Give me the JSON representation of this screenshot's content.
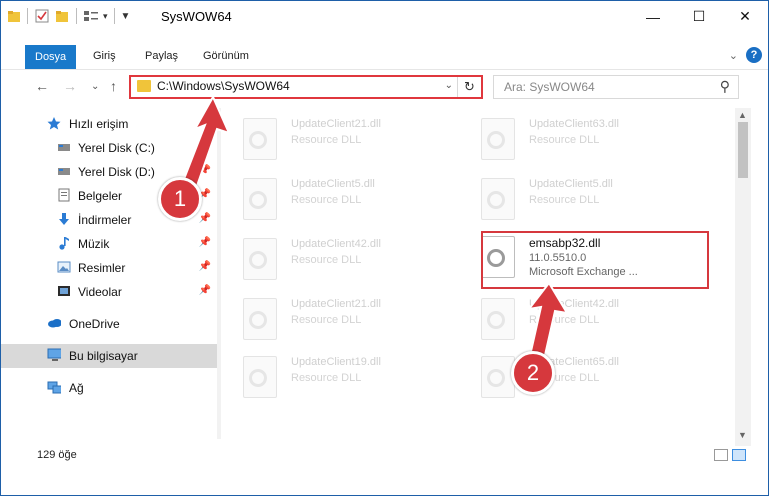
{
  "window": {
    "title": "SysWOW64"
  },
  "ribbon": {
    "tabs": [
      {
        "label": "Dosya",
        "active": true
      },
      {
        "label": "Giriş"
      },
      {
        "label": "Paylaş"
      },
      {
        "label": "Görünüm"
      }
    ]
  },
  "address": {
    "path": "C:\\Windows\\SysWOW64"
  },
  "search": {
    "placeholder": "Ara: SysWOW64"
  },
  "sidebar": {
    "items": [
      {
        "label": "Hızlı erişim",
        "icon": "star-icon"
      },
      {
        "label": "Yerel Disk (C:)",
        "icon": "drive-icon"
      },
      {
        "label": "Yerel Disk (D:)",
        "icon": "drive-icon"
      },
      {
        "label": "Belgeler",
        "icon": "documents-icon"
      },
      {
        "label": "İndirmeler",
        "icon": "download-icon"
      },
      {
        "label": "Müzik",
        "icon": "music-icon"
      },
      {
        "label": "Resimler",
        "icon": "pictures-icon"
      },
      {
        "label": "Videolar",
        "icon": "videos-icon"
      },
      {
        "label": "OneDrive",
        "icon": "cloud-icon"
      },
      {
        "label": "Bu bilgisayar",
        "icon": "computer-icon",
        "selected": true
      },
      {
        "label": "Ağ",
        "icon": "network-icon"
      }
    ]
  },
  "files": [
    {
      "name": "UpdateClient21.dll",
      "type": "Resource DLL"
    },
    {
      "name": "UpdateClient63.dll",
      "type": "Resource DLL"
    },
    {
      "name": "UpdateClient5.dll",
      "type": "Resource DLL"
    },
    {
      "name": "UpdateClient5.dll",
      "type": "Resource DLL"
    },
    {
      "name": "UpdateClient42.dll",
      "type": "Resource DLL"
    },
    {
      "name": "emsabp32.dll",
      "version": "11.0.5510.0",
      "type": "Microsoft Exchange ...",
      "highlighted": true
    },
    {
      "name": "UpdateClient21.dll",
      "type": "Resource DLL"
    },
    {
      "name": "UpdateClient42.dll",
      "type": "Resource DLL"
    },
    {
      "name": "UpdateClient19.dll",
      "type": "Resource DLL"
    },
    {
      "name": "UpdateClient65.dll",
      "type": "Resource DLL"
    }
  ],
  "status": {
    "item_count": "129 öğe"
  },
  "annotations": {
    "step1": "1",
    "step2": "2"
  },
  "colors": {
    "accent": "#1979ca",
    "highlight": "#d6383d"
  }
}
